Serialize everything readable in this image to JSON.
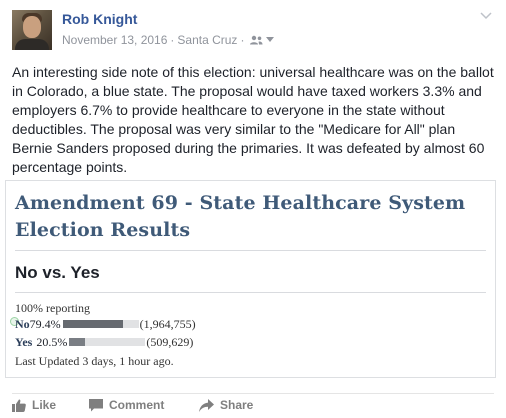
{
  "post": {
    "author": "Rob Knight",
    "date": "November 13, 2016",
    "separator": "·",
    "location": "Santa Cruz",
    "body": "An interesting side note of this election: universal healthcare was on the ballot in Colorado, a blue state. The proposal would have taxed workers 3.3% and employers 6.7% to provide healthcare to everyone in the state without deductibles. The proposal was very similar to the \"Medicare for All\" plan Bernie Sanders proposed during the primaries. It was defeated by almost 60 percentage points."
  },
  "card": {
    "title": "Amendment 69 - State Healthcare System Election Results",
    "subtitle": "No vs. Yes",
    "reporting": "100% reporting",
    "results": [
      {
        "choice": "No",
        "percent_label": "79.4%",
        "share": 0.794,
        "votes": "(1,964,755)"
      },
      {
        "choice": "Yes",
        "percent_label": "20.5%",
        "share": 0.205,
        "votes": "(509,629)"
      }
    ],
    "updated": "Last Updated 3 days, 1 hour ago."
  },
  "actions": {
    "like": "Like",
    "comment": "Comment",
    "share": "Share"
  },
  "icons": {
    "audience": "friends-icon",
    "privacy_menu": "caret-down-icon",
    "post_menu": "chevron-down-icon",
    "winner": "check-icon",
    "like": "thumbs-up-icon",
    "comment": "comment-bubble-icon",
    "share": "share-arrow-icon"
  },
  "colors": {
    "author_link": "#365899",
    "meta_text": "#90949c",
    "card_title": "#3f5a78",
    "action_text": "#7f7f7f"
  }
}
